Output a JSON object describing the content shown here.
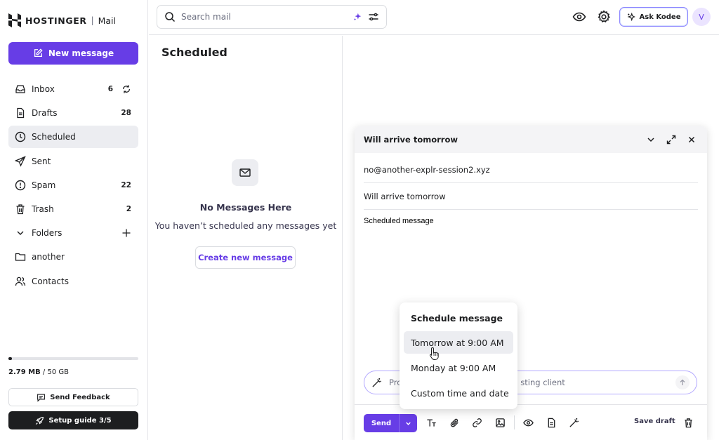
{
  "brand": {
    "name": "HOSTINGER",
    "separator": "|",
    "product": "Mail"
  },
  "sidebar": {
    "new_message": "New message",
    "items": [
      {
        "label": "Inbox",
        "count": "6",
        "icon": "inbox-icon"
      },
      {
        "label": "Drafts",
        "count": "28",
        "icon": "draft-icon"
      },
      {
        "label": "Scheduled",
        "count": "",
        "icon": "clock-icon"
      },
      {
        "label": "Sent",
        "count": "",
        "icon": "send-icon"
      },
      {
        "label": "Spam",
        "count": "22",
        "icon": "spam-icon"
      },
      {
        "label": "Trash",
        "count": "2",
        "icon": "trash-icon"
      },
      {
        "label": "Folders",
        "count": "",
        "icon": "chevron-down-icon"
      },
      {
        "label": "another",
        "count": "",
        "icon": "folder-icon"
      },
      {
        "label": "Contacts",
        "count": "",
        "icon": "contacts-icon"
      }
    ],
    "storage": {
      "used": "2.79 MB",
      "total": "/ 50 GB",
      "fraction": 0.0001
    },
    "feedback": "Send Feedback",
    "setup_guide": "Setup guide 3/5"
  },
  "topbar": {
    "search_placeholder": "Search mail",
    "ask_kodee": "Ask Kodee",
    "avatar_initial": "V"
  },
  "list": {
    "title": "Scheduled",
    "empty_title": "No Messages Here",
    "empty_subtitle": "You haven’t scheduled any messages yet",
    "create_button": "Create new message"
  },
  "composer": {
    "title": "Will arrive tomorrow",
    "to": "no@another-explr-session2.xyz",
    "subject": "Will arrive tomorrow",
    "body": "Scheduled message",
    "ai_prompt_left": "Pro",
    "ai_prompt_right": "sting client",
    "send": "Send",
    "save_draft": "Save draft"
  },
  "schedule_menu": {
    "title": "Schedule message",
    "options": [
      "Tomorrow at 9:00 AM",
      "Monday at 9:00 AM",
      "Custom time and date"
    ]
  },
  "colors": {
    "accent": "#673de6",
    "dark": "#1d1e20",
    "active_bg": "#ecedf1"
  }
}
